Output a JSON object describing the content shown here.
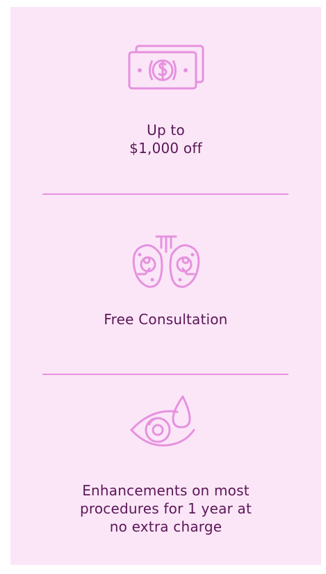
{
  "benefits": [
    {
      "icon": "money-icon",
      "text": "Up to\n$1,000 off"
    },
    {
      "icon": "eye-exam-device-icon",
      "text": "Free Consultation"
    },
    {
      "icon": "eye-drop-icon",
      "text": "Enhancements on most\nprocedures for 1 year at\nno extra charge"
    }
  ],
  "colors": {
    "background": "#fbe6f8",
    "icon": "#e592de",
    "divider": "#e592de",
    "text": "#5a1656"
  }
}
